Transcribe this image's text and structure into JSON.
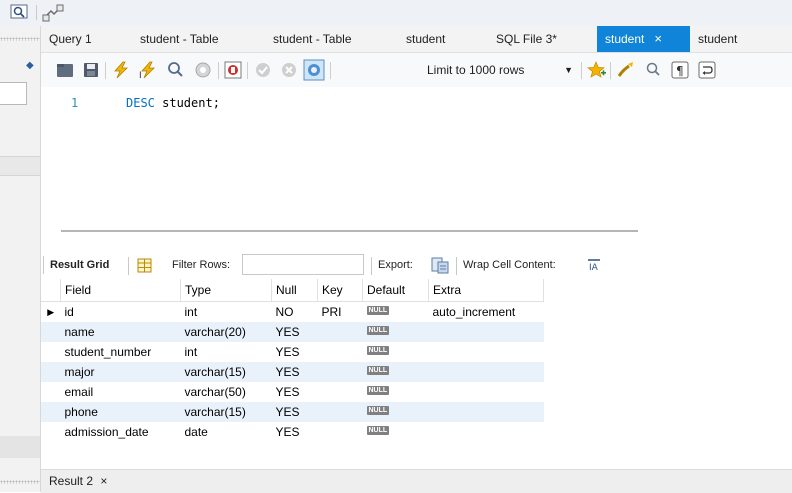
{
  "tabs": [
    {
      "label": "Query 1",
      "active": false
    },
    {
      "label": "student - Table",
      "active": false
    },
    {
      "label": "student - Table",
      "active": false
    },
    {
      "label": "student",
      "active": false
    },
    {
      "label": "SQL File 3*",
      "active": false
    },
    {
      "label": "student",
      "active": true,
      "close": "×"
    },
    {
      "label": "student",
      "active": false
    }
  ],
  "toolbar": {
    "limit_label": "Limit to 1000 rows",
    "icons": [
      "open-folder-icon",
      "save-icon",
      "execute-lightning-icon",
      "execute-cursor-icon",
      "explain-magnifier-icon",
      "stop-icon",
      "toggle-error-icon",
      "commit-icon",
      "rollback-icon",
      "autocommit-icon",
      "add-snippet-star-icon",
      "beautify-brush-icon",
      "find-icon",
      "invisible-chars-icon",
      "wrap-icon"
    ]
  },
  "editor": {
    "line_number": "1",
    "keyword": "DESC",
    "rest": " student;"
  },
  "result_toolbar": {
    "result_grid": "Result Grid",
    "filter_rows": "Filter Rows:",
    "filter_value": "",
    "export": "Export:",
    "wrap": "Wrap Cell Content:"
  },
  "grid": {
    "columns": [
      "Field",
      "Type",
      "Null",
      "Key",
      "Default",
      "Extra"
    ],
    "null_label": "NULL",
    "rows": [
      {
        "field": "id",
        "type": "int",
        "null": "NO",
        "key": "PRI",
        "extra": "auto_increment"
      },
      {
        "field": "name",
        "type": "varchar(20)",
        "null": "YES",
        "key": "",
        "extra": ""
      },
      {
        "field": "student_number",
        "type": "int",
        "null": "YES",
        "key": "",
        "extra": ""
      },
      {
        "field": "major",
        "type": "varchar(15)",
        "null": "YES",
        "key": "",
        "extra": ""
      },
      {
        "field": "email",
        "type": "varchar(50)",
        "null": "YES",
        "key": "",
        "extra": ""
      },
      {
        "field": "phone",
        "type": "varchar(15)",
        "null": "YES",
        "key": "",
        "extra": ""
      },
      {
        "field": "admission_date",
        "type": "date",
        "null": "YES",
        "key": "",
        "extra": ""
      }
    ]
  },
  "bottom_tab": {
    "label": "Result 2",
    "close": "×"
  },
  "colors": {
    "accent": "#0f84d9",
    "row_alt": "#e9f1fb",
    "keyword": "#0071c5",
    "line_number": "#2b91af"
  }
}
